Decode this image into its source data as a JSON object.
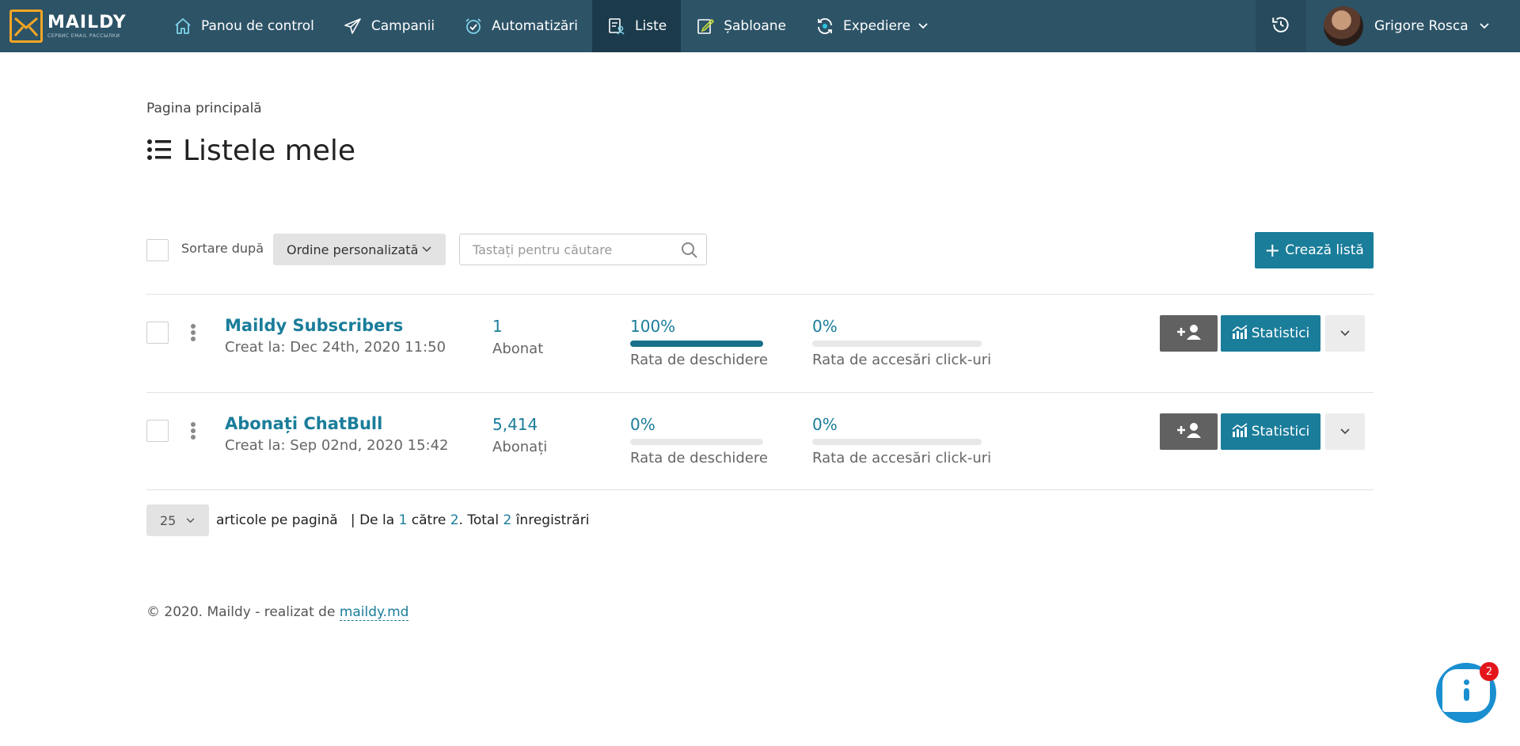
{
  "brand": {
    "name": "MAILDY",
    "tagline": "СЕРВИС EMAIL РАССЫЛКИ"
  },
  "nav": {
    "items": [
      {
        "label": "Panou de control",
        "icon": "home-icon"
      },
      {
        "label": "Campanii",
        "icon": "paper-plane-icon"
      },
      {
        "label": "Automatizări",
        "icon": "alarm-clock-icon"
      },
      {
        "label": "Liste",
        "icon": "list-users-icon",
        "active": true
      },
      {
        "label": "Șabloane",
        "icon": "edit-template-icon"
      },
      {
        "label": "Expediere",
        "icon": "sync-icon",
        "has_dropdown": true
      }
    ],
    "history_icon": "history-icon",
    "user": {
      "name": "Grigore Rosca"
    }
  },
  "breadcrumb": "Pagina principală",
  "page_title": "Listele mele",
  "toolbar": {
    "sort_label": "Sortare după",
    "sort_value": "Ordine personalizată",
    "search_placeholder": "Tastați pentru căutare",
    "create_label": "Crează listă"
  },
  "lists": [
    {
      "name": "Maildy Subscribers",
      "created": "Creat la: Dec 24th, 2020 11:50",
      "subscribers": "1",
      "subscribers_label": "Abonat",
      "open_rate": "100%",
      "open_rate_value": 100,
      "open_rate_label": "Rata de deschidere",
      "click_rate": "0%",
      "click_rate_value": 0,
      "click_rate_label": "Rata de accesări click-uri",
      "stats_label": "Statistici"
    },
    {
      "name": "Abonați ChatBull",
      "created": "Creat la: Sep 02nd, 2020 15:42",
      "subscribers": "5,414",
      "subscribers_label": "Abonați",
      "open_rate": "0%",
      "open_rate_value": 0,
      "open_rate_label": "Rata de deschidere",
      "click_rate": "0%",
      "click_rate_value": 0,
      "click_rate_label": "Rata de accesări click-uri",
      "stats_label": "Statistici"
    }
  ],
  "pagination": {
    "per_page": "25",
    "per_page_label": "articole pe pagină",
    "sep": "|",
    "from_label": "De la",
    "from": "1",
    "to_label": "către",
    "to": "2",
    "total_label": ". Total",
    "total": "2",
    "records_label": "înregistrări"
  },
  "footer": {
    "text": "© 2020. Maildy - realizat de",
    "link": "maildy.md"
  },
  "chat": {
    "badge": "2"
  },
  "colors": {
    "nav_bg": "#2d5367",
    "nav_active": "#1b3b4c",
    "accent": "#1a7d9a",
    "logo": "#f5a623",
    "badge": "#e3161b"
  }
}
